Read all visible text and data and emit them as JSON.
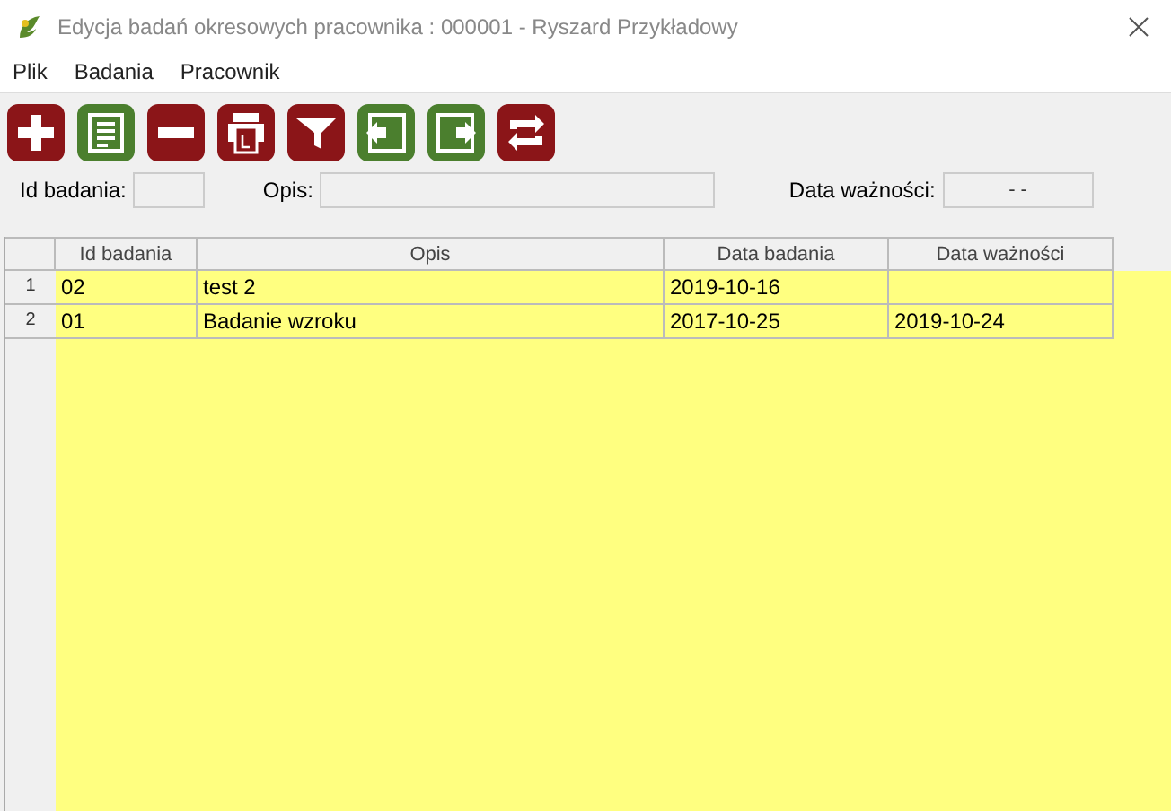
{
  "window": {
    "title": "Edycja badań okresowych pracownika : 000001 - Ryszard Przykładowy"
  },
  "menu": [
    "Plik",
    "Badania",
    "Pracownik"
  ],
  "toolbar": [
    {
      "kind": "add",
      "color": "#8b1518"
    },
    {
      "kind": "list",
      "color": "#4b7f2e"
    },
    {
      "kind": "remove",
      "color": "#8b1518"
    },
    {
      "kind": "print",
      "color": "#8b1518"
    },
    {
      "kind": "filter",
      "color": "#8b1518"
    },
    {
      "kind": "prev",
      "color": "#4b7f2e"
    },
    {
      "kind": "next",
      "color": "#4b7f2e"
    },
    {
      "kind": "refresh",
      "color": "#8b1518"
    }
  ],
  "form": {
    "id_label": "Id badania:",
    "opis_label": "Opis:",
    "date_label": "Data ważności:",
    "date_value": "-  -"
  },
  "table": {
    "columns": [
      "Id badania",
      "Opis",
      "Data badania",
      "Data ważności"
    ],
    "rows": [
      {
        "number": "1",
        "cells": [
          "02",
          "test 2",
          "2019-10-16",
          ""
        ]
      },
      {
        "number": "2",
        "cells": [
          "01",
          "Badanie wzroku",
          "2017-10-25",
          "2019-10-24"
        ]
      }
    ]
  }
}
